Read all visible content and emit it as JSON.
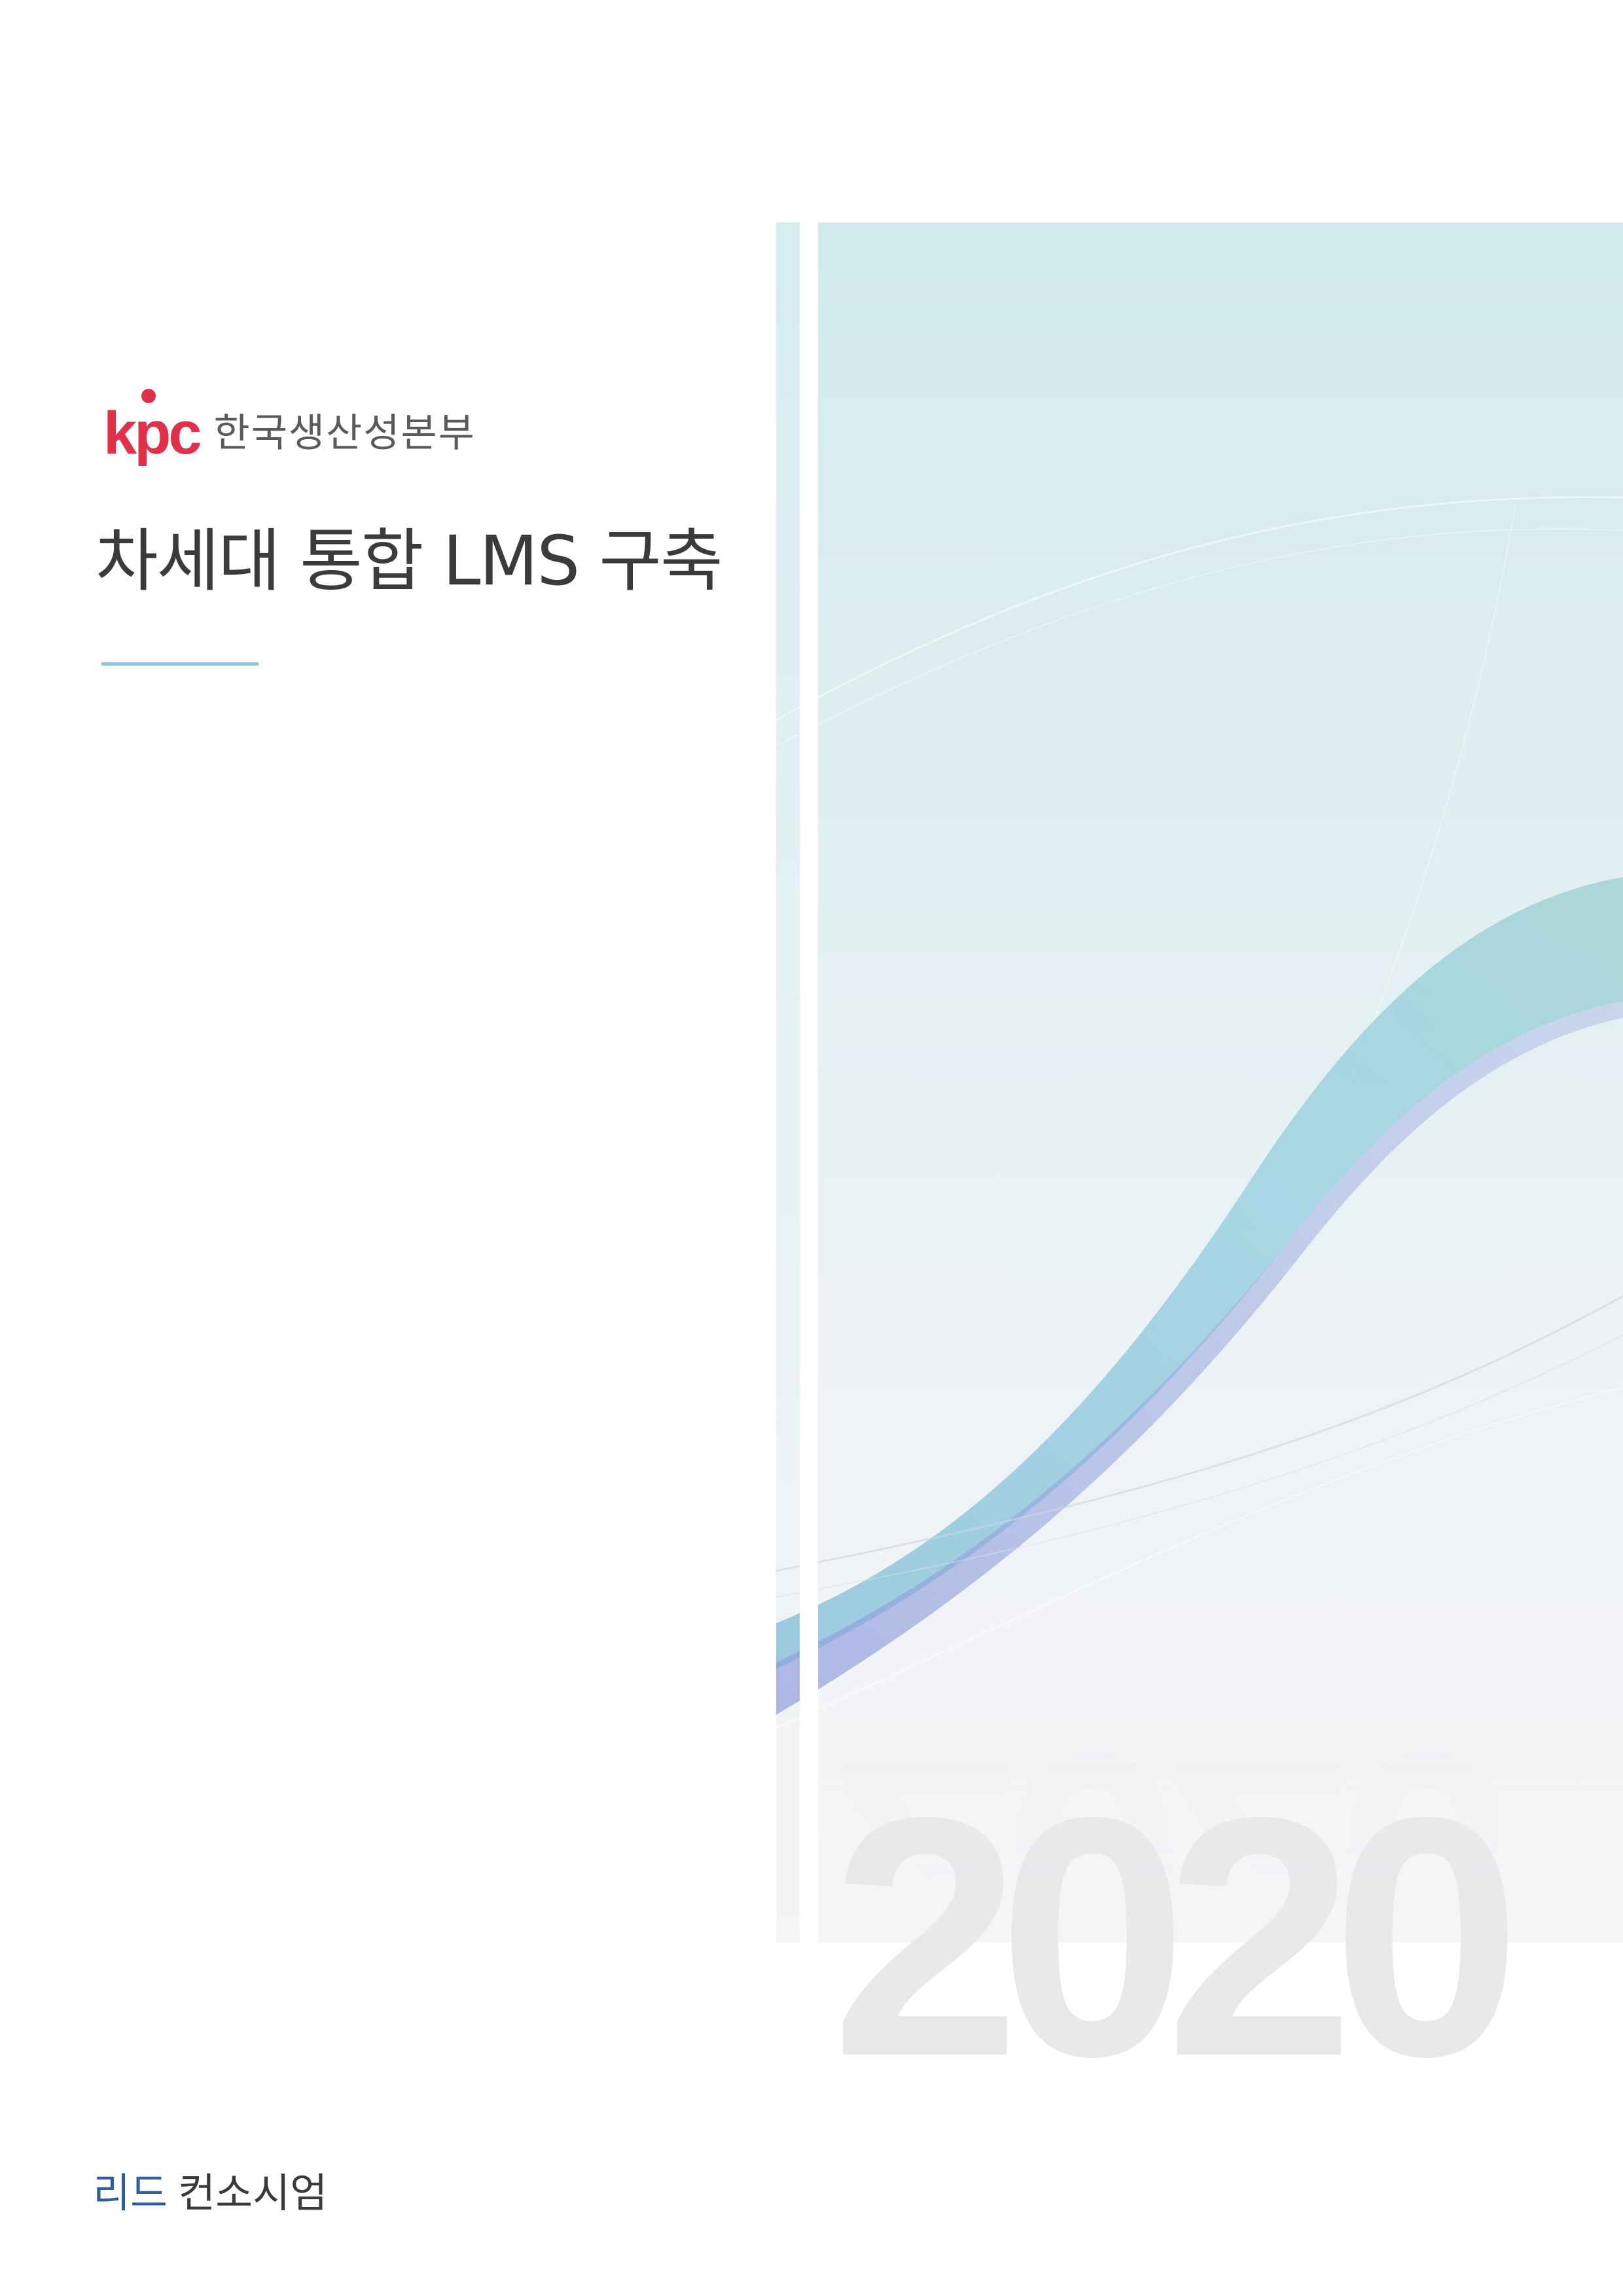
{
  "header": {
    "logo_mark": "kpc",
    "org_name": "한국생산성본부"
  },
  "document": {
    "title": "차세대 통합 LMS 구축",
    "year": "2020"
  },
  "footer": {
    "company_part1": "리드",
    "company_part2": "컨소시엄"
  },
  "colors": {
    "brand_red": "#e0304a",
    "accent_teal": "#8ec7d7",
    "footer_blue": "#2f5f9e"
  }
}
